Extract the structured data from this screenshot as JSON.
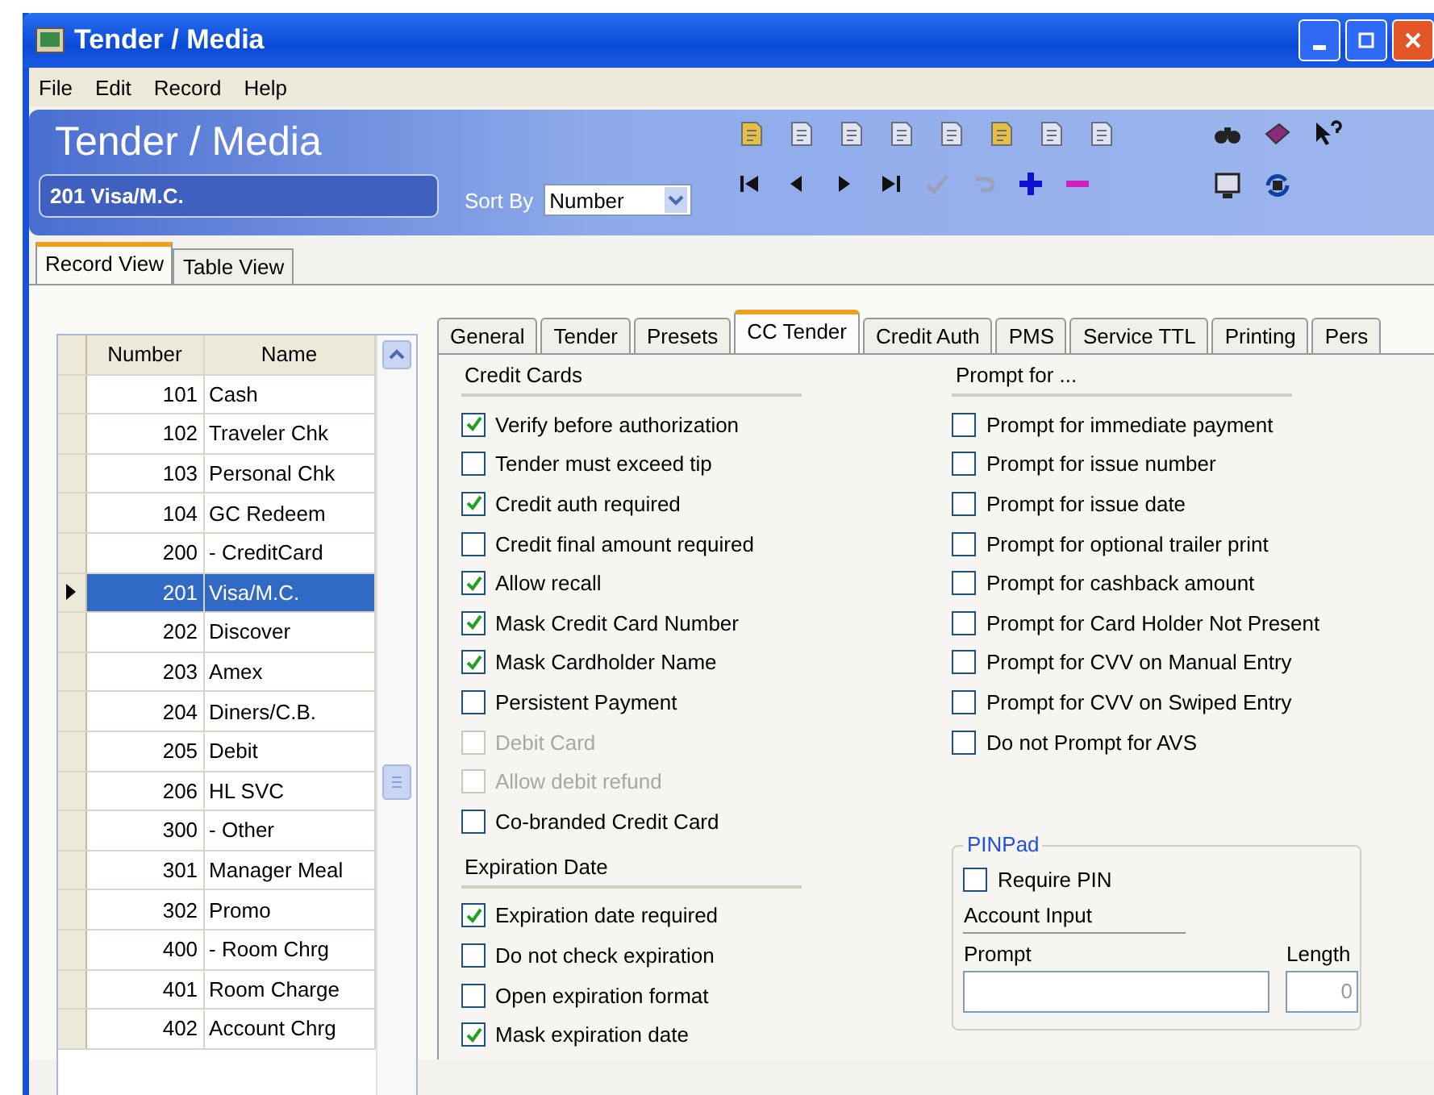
{
  "window": {
    "title": "Tender / Media"
  },
  "menu": [
    "File",
    "Edit",
    "Record",
    "Help"
  ],
  "header": {
    "title": "Tender / Media",
    "record": "201 Visa/M.C.",
    "sort_label": "Sort By",
    "sort_value": "Number"
  },
  "view_tabs": [
    {
      "label": "Record View",
      "selected": true
    },
    {
      "label": "Table View",
      "selected": false
    }
  ],
  "table": {
    "columns": [
      "Number",
      "Name"
    ],
    "rows": [
      {
        "number": "101",
        "name": "Cash",
        "selected": false
      },
      {
        "number": "102",
        "name": "Traveler Chk",
        "selected": false
      },
      {
        "number": "103",
        "name": "Personal Chk",
        "selected": false
      },
      {
        "number": "104",
        "name": "GC Redeem",
        "selected": false
      },
      {
        "number": "200",
        "name": "- CreditCard",
        "selected": false
      },
      {
        "number": "201",
        "name": "Visa/M.C.",
        "selected": true
      },
      {
        "number": "202",
        "name": "Discover",
        "selected": false
      },
      {
        "number": "203",
        "name": "Amex",
        "selected": false
      },
      {
        "number": "204",
        "name": "Diners/C.B.",
        "selected": false
      },
      {
        "number": "205",
        "name": "Debit",
        "selected": false
      },
      {
        "number": "206",
        "name": "HL SVC",
        "selected": false
      },
      {
        "number": "300",
        "name": "- Other",
        "selected": false
      },
      {
        "number": "301",
        "name": "Manager Meal",
        "selected": false
      },
      {
        "number": "302",
        "name": "Promo",
        "selected": false
      },
      {
        "number": "400",
        "name": "- Room Chrg",
        "selected": false
      },
      {
        "number": "401",
        "name": "Room Charge",
        "selected": false
      },
      {
        "number": "402",
        "name": "Account Chrg",
        "selected": false
      }
    ]
  },
  "tabs": [
    {
      "label": "General",
      "selected": false
    },
    {
      "label": "Tender",
      "selected": false
    },
    {
      "label": "Presets",
      "selected": false
    },
    {
      "label": "CC Tender",
      "selected": true
    },
    {
      "label": "Credit Auth",
      "selected": false
    },
    {
      "label": "PMS",
      "selected": false
    },
    {
      "label": "Service TTL",
      "selected": false
    },
    {
      "label": "Printing",
      "selected": false
    },
    {
      "label": "Pers",
      "selected": false
    }
  ],
  "credit_cards": {
    "title": "Credit Cards",
    "options": [
      {
        "label": "Verify before authorization",
        "checked": true,
        "disabled": false
      },
      {
        "label": "Tender must exceed tip",
        "checked": false,
        "disabled": false
      },
      {
        "label": "Credit auth required",
        "checked": true,
        "disabled": false
      },
      {
        "label": "Credit final amount required",
        "checked": false,
        "disabled": false
      },
      {
        "label": "Allow recall",
        "checked": true,
        "disabled": false
      },
      {
        "label": "Mask Credit Card Number",
        "checked": true,
        "disabled": false
      },
      {
        "label": "Mask Cardholder Name",
        "checked": true,
        "disabled": false
      },
      {
        "label": "Persistent Payment",
        "checked": false,
        "disabled": false
      },
      {
        "label": "Debit Card",
        "checked": false,
        "disabled": true
      },
      {
        "label": "Allow debit refund",
        "checked": false,
        "disabled": true
      },
      {
        "label": "Co-branded Credit Card",
        "checked": false,
        "disabled": false
      }
    ]
  },
  "expiration": {
    "title": "Expiration Date",
    "options": [
      {
        "label": "Expiration date required",
        "checked": true,
        "disabled": false
      },
      {
        "label": "Do not check expiration",
        "checked": false,
        "disabled": false
      },
      {
        "label": "Open expiration format",
        "checked": false,
        "disabled": false
      },
      {
        "label": "Mask expiration date",
        "checked": true,
        "disabled": false
      }
    ]
  },
  "prompt_for": {
    "title": "Prompt for ...",
    "options": [
      {
        "label": "Prompt for immediate payment",
        "checked": false,
        "disabled": false
      },
      {
        "label": "Prompt for issue number",
        "checked": false,
        "disabled": false
      },
      {
        "label": "Prompt for issue date",
        "checked": false,
        "disabled": false
      },
      {
        "label": "Prompt for optional trailer print",
        "checked": false,
        "disabled": false
      },
      {
        "label": "Prompt for cashback amount",
        "checked": false,
        "disabled": false
      },
      {
        "label": "Prompt for Card Holder Not Present",
        "checked": false,
        "disabled": false
      },
      {
        "label": "Prompt for CVV on Manual Entry",
        "checked": false,
        "disabled": false
      },
      {
        "label": "Prompt for CVV on Swiped Entry",
        "checked": false,
        "disabled": false
      },
      {
        "label": "Do not Prompt for AVS",
        "checked": false,
        "disabled": false
      }
    ]
  },
  "pinpad": {
    "title": "PINPad",
    "require_pin": {
      "label": "Require PIN",
      "checked": false
    },
    "account_input": "Account Input",
    "prompt_label": "Prompt",
    "length_label": "Length",
    "length_value": "0"
  }
}
